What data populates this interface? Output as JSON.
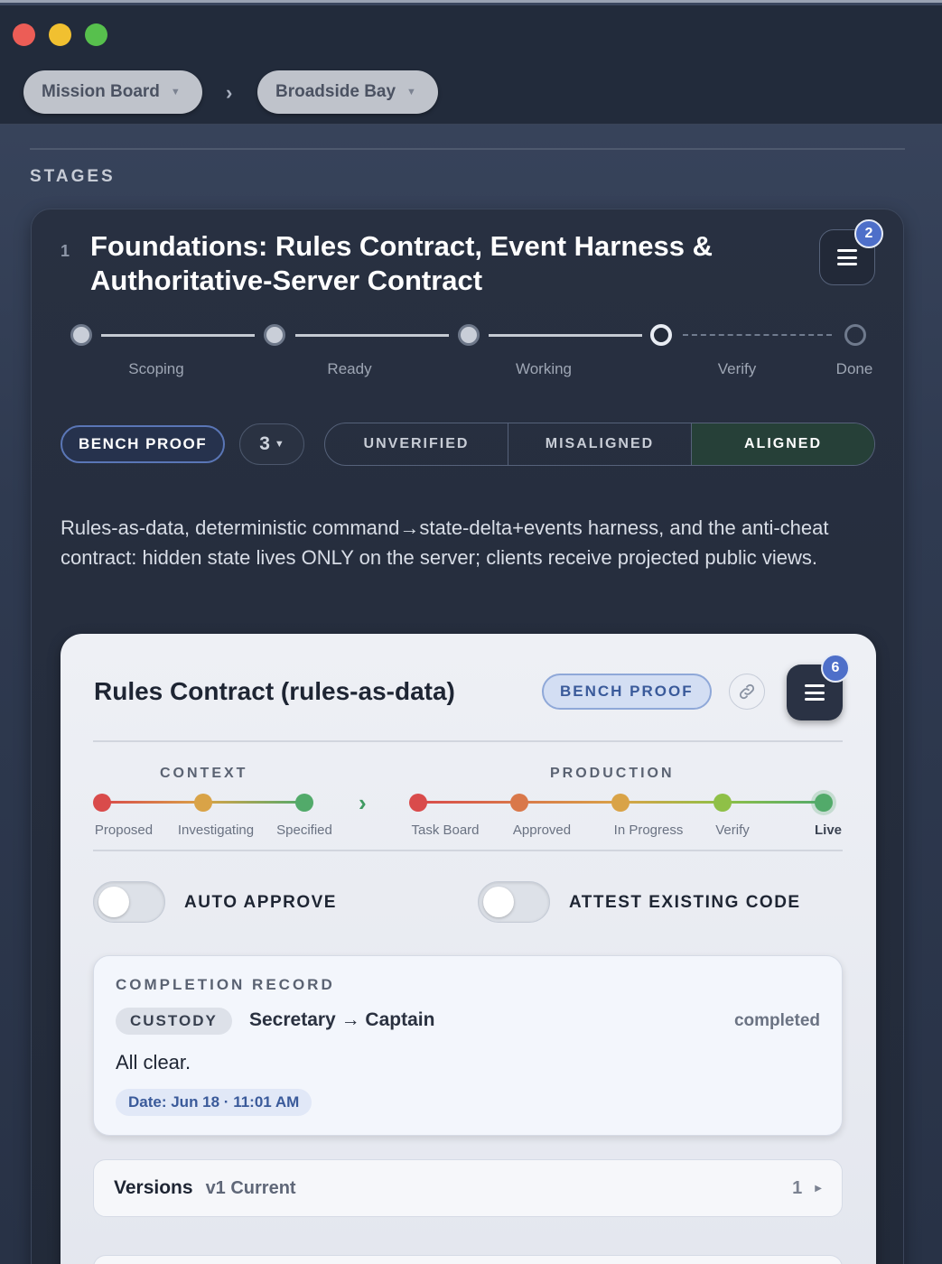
{
  "breadcrumb": {
    "items": [
      {
        "label": "Mission Board"
      },
      {
        "label": "Broadside Bay"
      }
    ],
    "separator": "›"
  },
  "section": {
    "label": "STAGES"
  },
  "stage": {
    "number": "1",
    "title": "Foundations: Rules Contract, Event Harness & Authoritative-Server Contract",
    "menu_badge": "2",
    "progress": {
      "steps": [
        "Scoping",
        "Ready",
        "Working",
        "Verify",
        "Done"
      ],
      "current": "Verify"
    },
    "bench_label": "BENCH PROOF",
    "count_value": "3",
    "alignment": {
      "options": [
        "UNVERIFIED",
        "MISALIGNED",
        "ALIGNED"
      ],
      "selected": "ALIGNED"
    },
    "description": "Rules-as-data, deterministic command→state-delta+events harness, and the anti-cheat contract: hidden state lives ONLY on the server; clients receive projected public views."
  },
  "task": {
    "title": "Rules Contract (rules-as-data)",
    "bench_label": "BENCH PROOF",
    "menu_badge": "6",
    "context": {
      "label": "CONTEXT",
      "steps": [
        "Proposed",
        "Investigating",
        "Specified"
      ]
    },
    "production": {
      "label": "PRODUCTION",
      "steps": [
        "Task Board",
        "Approved",
        "In Progress",
        "Verify",
        "Live"
      ],
      "current": "Live"
    },
    "colors": {
      "red": "#d94b4b",
      "orange": "#d9784a",
      "amber": "#d9a347",
      "lime": "#8fc047",
      "green": "#52aa6a"
    },
    "toggles": {
      "auto_approve": {
        "label": "AUTO APPROVE",
        "on": false
      },
      "attest_existing": {
        "label": "ATTEST EXISTING CODE",
        "on": false
      }
    },
    "completion": {
      "heading": "COMPLETION RECORD",
      "custody_label": "CUSTODY",
      "custody_path": "Secretary → Captain",
      "status": "completed",
      "note": "All clear.",
      "date": "Date: Jun 18 · 11:01 AM"
    },
    "versions": {
      "label": "Versions",
      "current": "v1 Current",
      "count": "1"
    }
  }
}
